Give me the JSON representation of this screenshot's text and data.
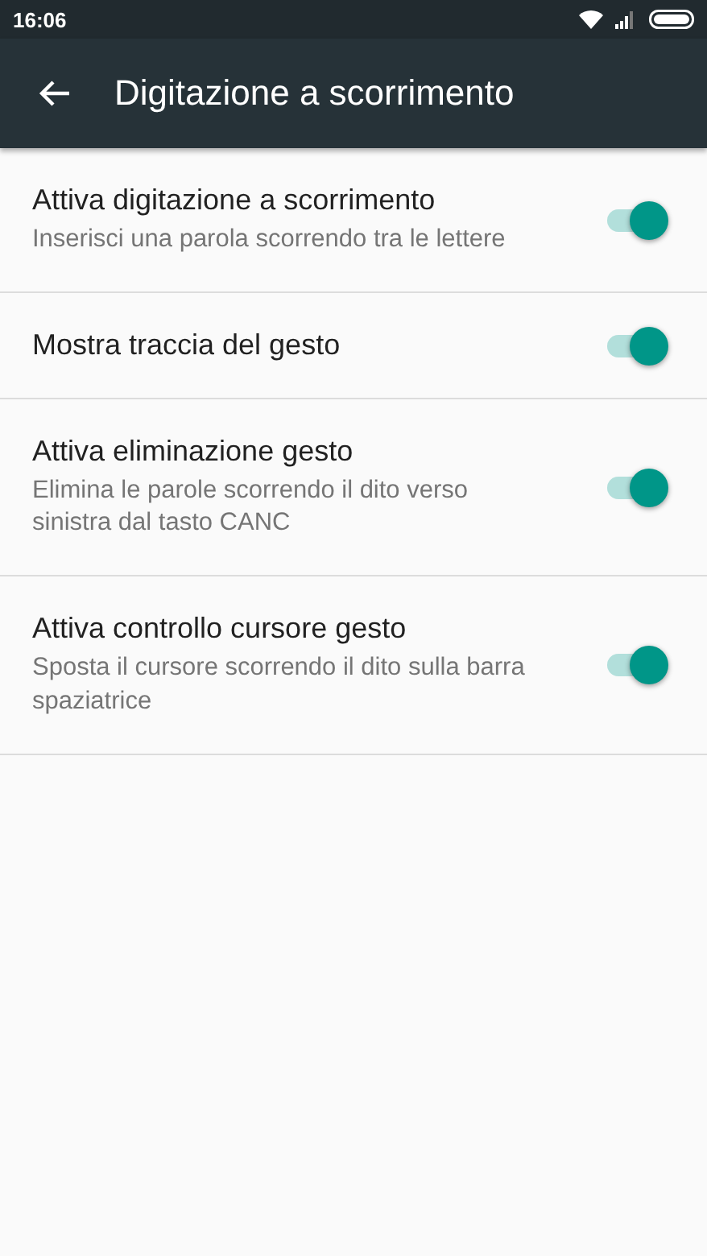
{
  "status_bar": {
    "time": "16:06"
  },
  "app_bar": {
    "title": "Digitazione a scorrimento"
  },
  "settings": [
    {
      "title": "Attiva digitazione a scorrimento",
      "summary": "Inserisci una parola scorrendo tra le lettere",
      "on": true
    },
    {
      "title": "Mostra traccia del gesto",
      "on": true
    },
    {
      "title": "Attiva eliminazione gesto",
      "summary": "Elimina le parole scorrendo il dito verso sinistra dal tasto CANC",
      "on": true
    },
    {
      "title": "Attiva controllo cursore gesto",
      "summary": "Sposta il cursore scorrendo il dito sulla barra spaziatrice",
      "on": true
    }
  ]
}
